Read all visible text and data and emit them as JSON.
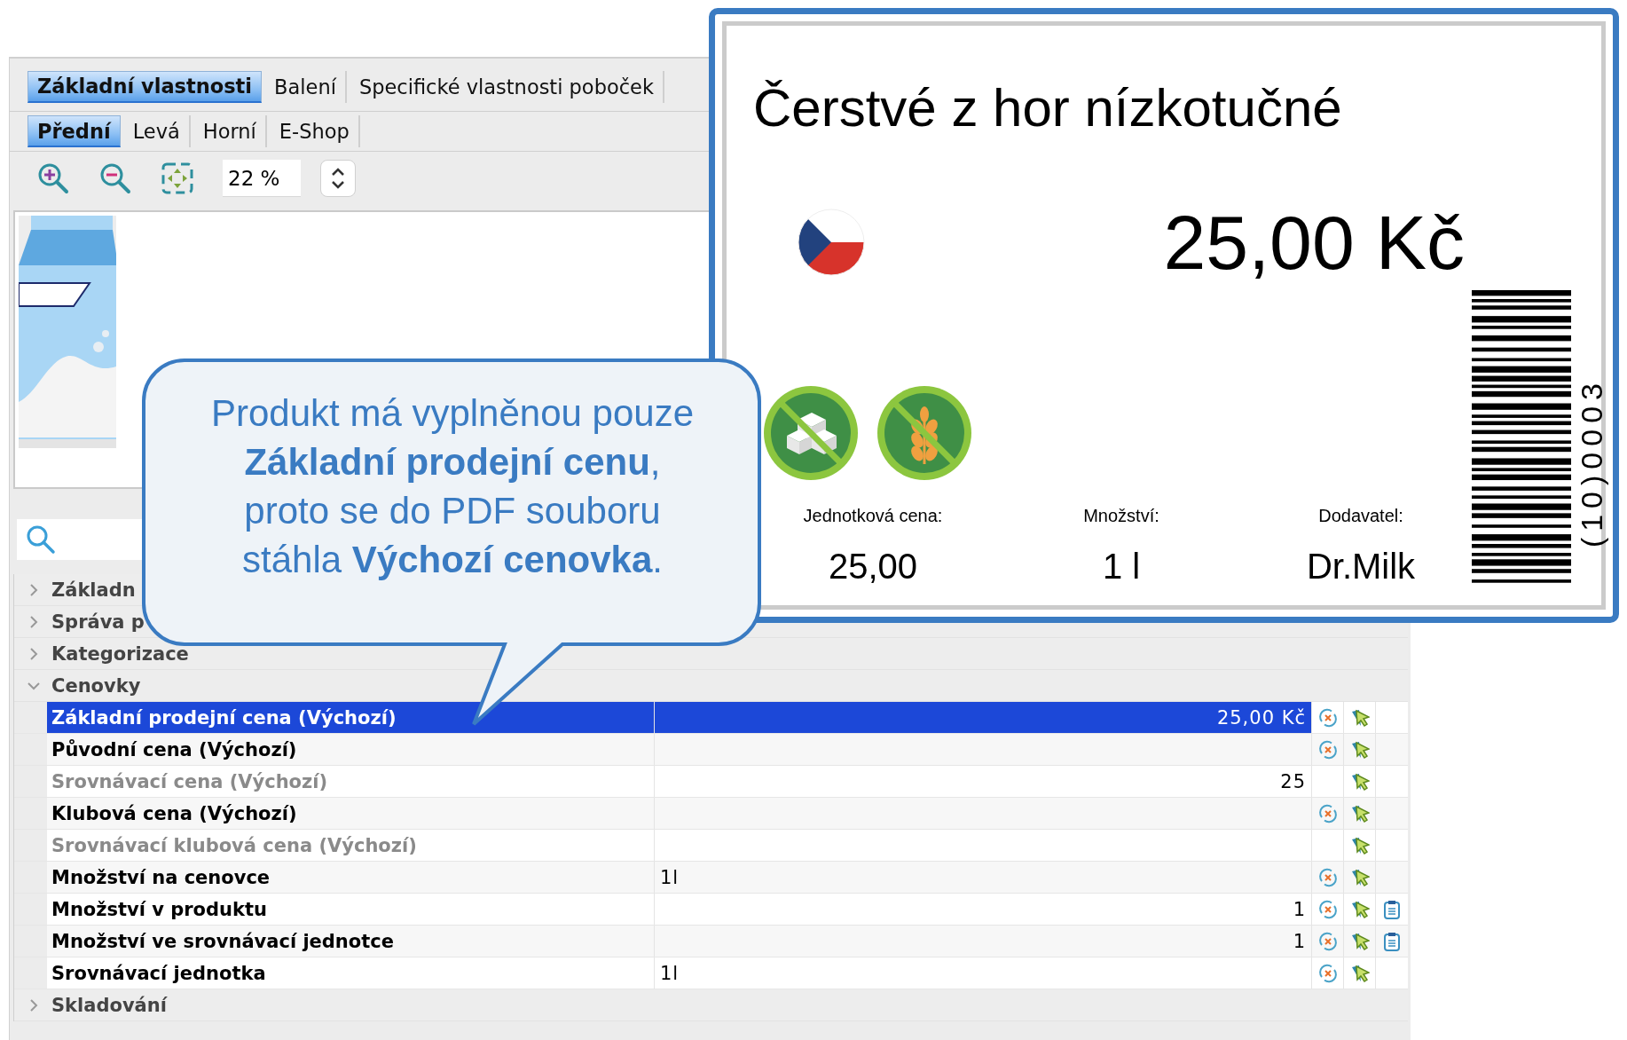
{
  "tabs": [
    {
      "label": "Základní vlastnosti",
      "selected": true
    },
    {
      "label": "Balení",
      "selected": false
    },
    {
      "label": "Specifické vlastnosti poboček",
      "selected": false
    }
  ],
  "view_tabs": [
    {
      "label": "Přední",
      "selected": true
    },
    {
      "label": "Levá",
      "selected": false
    },
    {
      "label": "Horní",
      "selected": false
    },
    {
      "label": "E-Shop",
      "selected": false
    }
  ],
  "zoom": {
    "value": "22 %"
  },
  "tree": [
    {
      "label": "Základn",
      "expanded": false
    },
    {
      "label": "Správa p",
      "expanded": false
    },
    {
      "label": "Kategorizace",
      "expanded": false
    },
    {
      "label": "Cenovky",
      "expanded": true,
      "children": [
        {
          "label": "Základní prodejní cena (Výchozí)",
          "value": "25,00 Kč",
          "kind": "number",
          "selected": true,
          "disabled": false,
          "reset": true,
          "cursor": true,
          "clipboard": false
        },
        {
          "label": "Původní cena (Výchozí)",
          "selected": false,
          "disabled": false,
          "reset": true,
          "cursor": true,
          "clipboard": false
        },
        {
          "label": "Srovnávací cena (Výchozí)",
          "value": "25",
          "kind": "number",
          "selected": false,
          "disabled": true,
          "reset": false,
          "cursor": true,
          "clipboard": false
        },
        {
          "label": "Klubová cena (Výchozí)",
          "selected": false,
          "disabled": false,
          "reset": true,
          "cursor": true,
          "clipboard": false
        },
        {
          "label": "Srovnávací klubová cena (Výchozí)",
          "selected": false,
          "disabled": true,
          "reset": false,
          "cursor": true,
          "clipboard": false
        },
        {
          "label": "Množství na cenovce",
          "value": "1l",
          "kind": "text",
          "selected": false,
          "disabled": false,
          "reset": true,
          "cursor": true,
          "clipboard": false
        },
        {
          "label": "Množství v produktu",
          "value": "1",
          "kind": "number",
          "selected": false,
          "disabled": false,
          "reset": true,
          "cursor": true,
          "clipboard": true
        },
        {
          "label": "Množství ve srovnávací jednotce",
          "value": "1",
          "kind": "number",
          "selected": false,
          "disabled": false,
          "reset": true,
          "cursor": true,
          "clipboard": true
        },
        {
          "label": "Srovnávací jednotka",
          "value": "1l",
          "kind": "text",
          "selected": false,
          "disabled": false,
          "reset": true,
          "cursor": true,
          "clipboard": false
        }
      ]
    },
    {
      "label": "Skladování",
      "expanded": false
    }
  ],
  "price_label": {
    "title": "Čerstvé z hor nízkotučné",
    "price": "25,00 Kč",
    "badges": [
      {
        "kind": "no-sugar"
      },
      {
        "kind": "no-gluten"
      }
    ],
    "fields": [
      {
        "label": "Jednotková cena:",
        "value": "25,00"
      },
      {
        "label": "Množství:",
        "value": "1 l"
      },
      {
        "label": "Dodavatel:",
        "value": "Dr.Milk"
      }
    ],
    "barcode": {
      "text": "(10)0003"
    }
  },
  "callout": {
    "text": "Produkt má vyplněnou pouze **Základní prodejní cenu**, proto se do PDF souboru stáhla **Výchozí cenovka**."
  }
}
